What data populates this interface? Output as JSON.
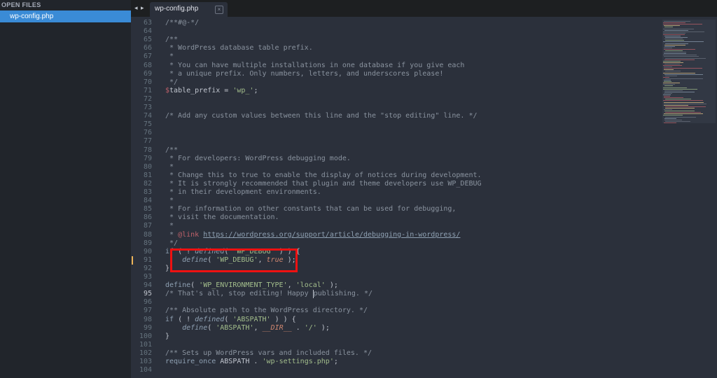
{
  "sidebar": {
    "header": "OPEN FILES",
    "files": [
      "wp-config.php"
    ]
  },
  "tabbar": {
    "nav_arrows": "◂ ▸",
    "active_tab": "wp-config.php",
    "close_glyph": "×"
  },
  "editor": {
    "active_line": 95,
    "modified_line": 91,
    "lines": [
      {
        "n": 63,
        "t": [
          [
            "cm",
            "/**#@-*/"
          ]
        ]
      },
      {
        "n": 64,
        "t": []
      },
      {
        "n": 65,
        "t": [
          [
            "cm",
            "/**"
          ]
        ]
      },
      {
        "n": 66,
        "t": [
          [
            "cm",
            " * WordPress database table prefix."
          ]
        ]
      },
      {
        "n": 67,
        "t": [
          [
            "cm",
            " *"
          ]
        ]
      },
      {
        "n": 68,
        "t": [
          [
            "cm",
            " * You can have multiple installations in one database if you give each"
          ]
        ]
      },
      {
        "n": 69,
        "t": [
          [
            "cm",
            " * a unique prefix. Only numbers, letters, and underscores please!"
          ]
        ]
      },
      {
        "n": 70,
        "t": [
          [
            "cm",
            " */"
          ]
        ]
      },
      {
        "n": 71,
        "t": [
          [
            "va",
            "$"
          ],
          [
            "",
            "table_prefix = "
          ],
          [
            "st",
            "'wp_'"
          ],
          [
            "",
            ";"
          ]
        ]
      },
      {
        "n": 72,
        "t": []
      },
      {
        "n": 73,
        "t": []
      },
      {
        "n": 74,
        "t": [
          [
            "cm",
            "/* Add any custom values between this line and the \"stop editing\" line. */"
          ]
        ]
      },
      {
        "n": 75,
        "t": []
      },
      {
        "n": 76,
        "t": []
      },
      {
        "n": 77,
        "t": []
      },
      {
        "n": 78,
        "t": [
          [
            "cm",
            "/**"
          ]
        ]
      },
      {
        "n": 79,
        "t": [
          [
            "cm",
            " * For developers: WordPress debugging mode."
          ]
        ]
      },
      {
        "n": 80,
        "t": [
          [
            "cm",
            " *"
          ]
        ]
      },
      {
        "n": 81,
        "t": [
          [
            "cm",
            " * Change this to true to enable the display of notices during development."
          ]
        ]
      },
      {
        "n": 82,
        "t": [
          [
            "cm",
            " * It is strongly recommended that plugin and theme developers use WP_DEBUG"
          ]
        ]
      },
      {
        "n": 83,
        "t": [
          [
            "cm",
            " * in their development environments."
          ]
        ]
      },
      {
        "n": 84,
        "t": [
          [
            "cm",
            " *"
          ]
        ]
      },
      {
        "n": 85,
        "t": [
          [
            "cm",
            " * For information on other constants that can be used for debugging,"
          ]
        ]
      },
      {
        "n": 86,
        "t": [
          [
            "cm",
            " * visit the documentation."
          ]
        ]
      },
      {
        "n": 87,
        "t": [
          [
            "cm",
            " *"
          ]
        ]
      },
      {
        "n": 88,
        "t": [
          [
            "cm",
            " * "
          ],
          [
            "tg",
            "@link"
          ],
          [
            "cm",
            " "
          ],
          [
            "ul",
            "https://wordpress.org/support/article/debugging-in-wordpress/"
          ]
        ]
      },
      {
        "n": 89,
        "t": [
          [
            "cm",
            " */"
          ]
        ]
      },
      {
        "n": 90,
        "t": [
          [
            "kw",
            "if"
          ],
          [
            "",
            " ( ! "
          ],
          [
            "fn",
            "defined"
          ],
          [
            "",
            "( "
          ],
          [
            "st",
            "'WP_DEBUG'"
          ],
          [
            "",
            " ) ) {"
          ]
        ]
      },
      {
        "n": 91,
        "t": [
          [
            "",
            "    "
          ],
          [
            "fn",
            "define"
          ],
          [
            "",
            "( "
          ],
          [
            "st",
            "'WP_DEBUG'"
          ],
          [
            "",
            ", "
          ],
          [
            "bo",
            "true"
          ],
          [
            "",
            " );"
          ]
        ]
      },
      {
        "n": 92,
        "t": [
          [
            "",
            "}"
          ]
        ]
      },
      {
        "n": 93,
        "t": []
      },
      {
        "n": 94,
        "t": [
          [
            "kw",
            "define"
          ],
          [
            "",
            "( "
          ],
          [
            "st",
            "'WP_ENVIRONMENT_TYPE'"
          ],
          [
            "",
            ", "
          ],
          [
            "st",
            "'local'"
          ],
          [
            "",
            " );"
          ]
        ]
      },
      {
        "n": 95,
        "t": [
          [
            "cm",
            "/* That's all, stop editing! Happy "
          ],
          [
            "cursor",
            ""
          ],
          [
            "cm",
            "publishing. */"
          ]
        ]
      },
      {
        "n": 96,
        "t": []
      },
      {
        "n": 97,
        "t": [
          [
            "cm",
            "/** Absolute path to the WordPress directory. */"
          ]
        ]
      },
      {
        "n": 98,
        "t": [
          [
            "kw",
            "if"
          ],
          [
            "",
            " ( ! "
          ],
          [
            "fn",
            "defined"
          ],
          [
            "",
            "( "
          ],
          [
            "st",
            "'ABSPATH'"
          ],
          [
            "",
            " ) ) {"
          ]
        ]
      },
      {
        "n": 99,
        "t": [
          [
            "",
            "    "
          ],
          [
            "fn",
            "define"
          ],
          [
            "",
            "( "
          ],
          [
            "st",
            "'ABSPATH'"
          ],
          [
            "",
            ", "
          ],
          [
            "bo",
            "__DIR__"
          ],
          [
            "",
            " . "
          ],
          [
            "st",
            "'/'"
          ],
          [
            "",
            " );"
          ]
        ]
      },
      {
        "n": 100,
        "t": [
          [
            "",
            "}"
          ]
        ]
      },
      {
        "n": 101,
        "t": []
      },
      {
        "n": 102,
        "t": [
          [
            "cm",
            "/** Sets up WordPress vars and included files. */"
          ]
        ]
      },
      {
        "n": 103,
        "t": [
          [
            "kw",
            "require_once"
          ],
          [
            "",
            " ABSPATH . "
          ],
          [
            "st",
            "'wp-settings.php'"
          ],
          [
            "",
            ";"
          ]
        ]
      },
      {
        "n": 104,
        "t": []
      }
    ]
  },
  "colors": {
    "editor_bg": "#2b303b",
    "sidebar_bg": "#21252b",
    "selected_file_bg": "#3a8bd6",
    "highlight_box": "#ee1111"
  }
}
